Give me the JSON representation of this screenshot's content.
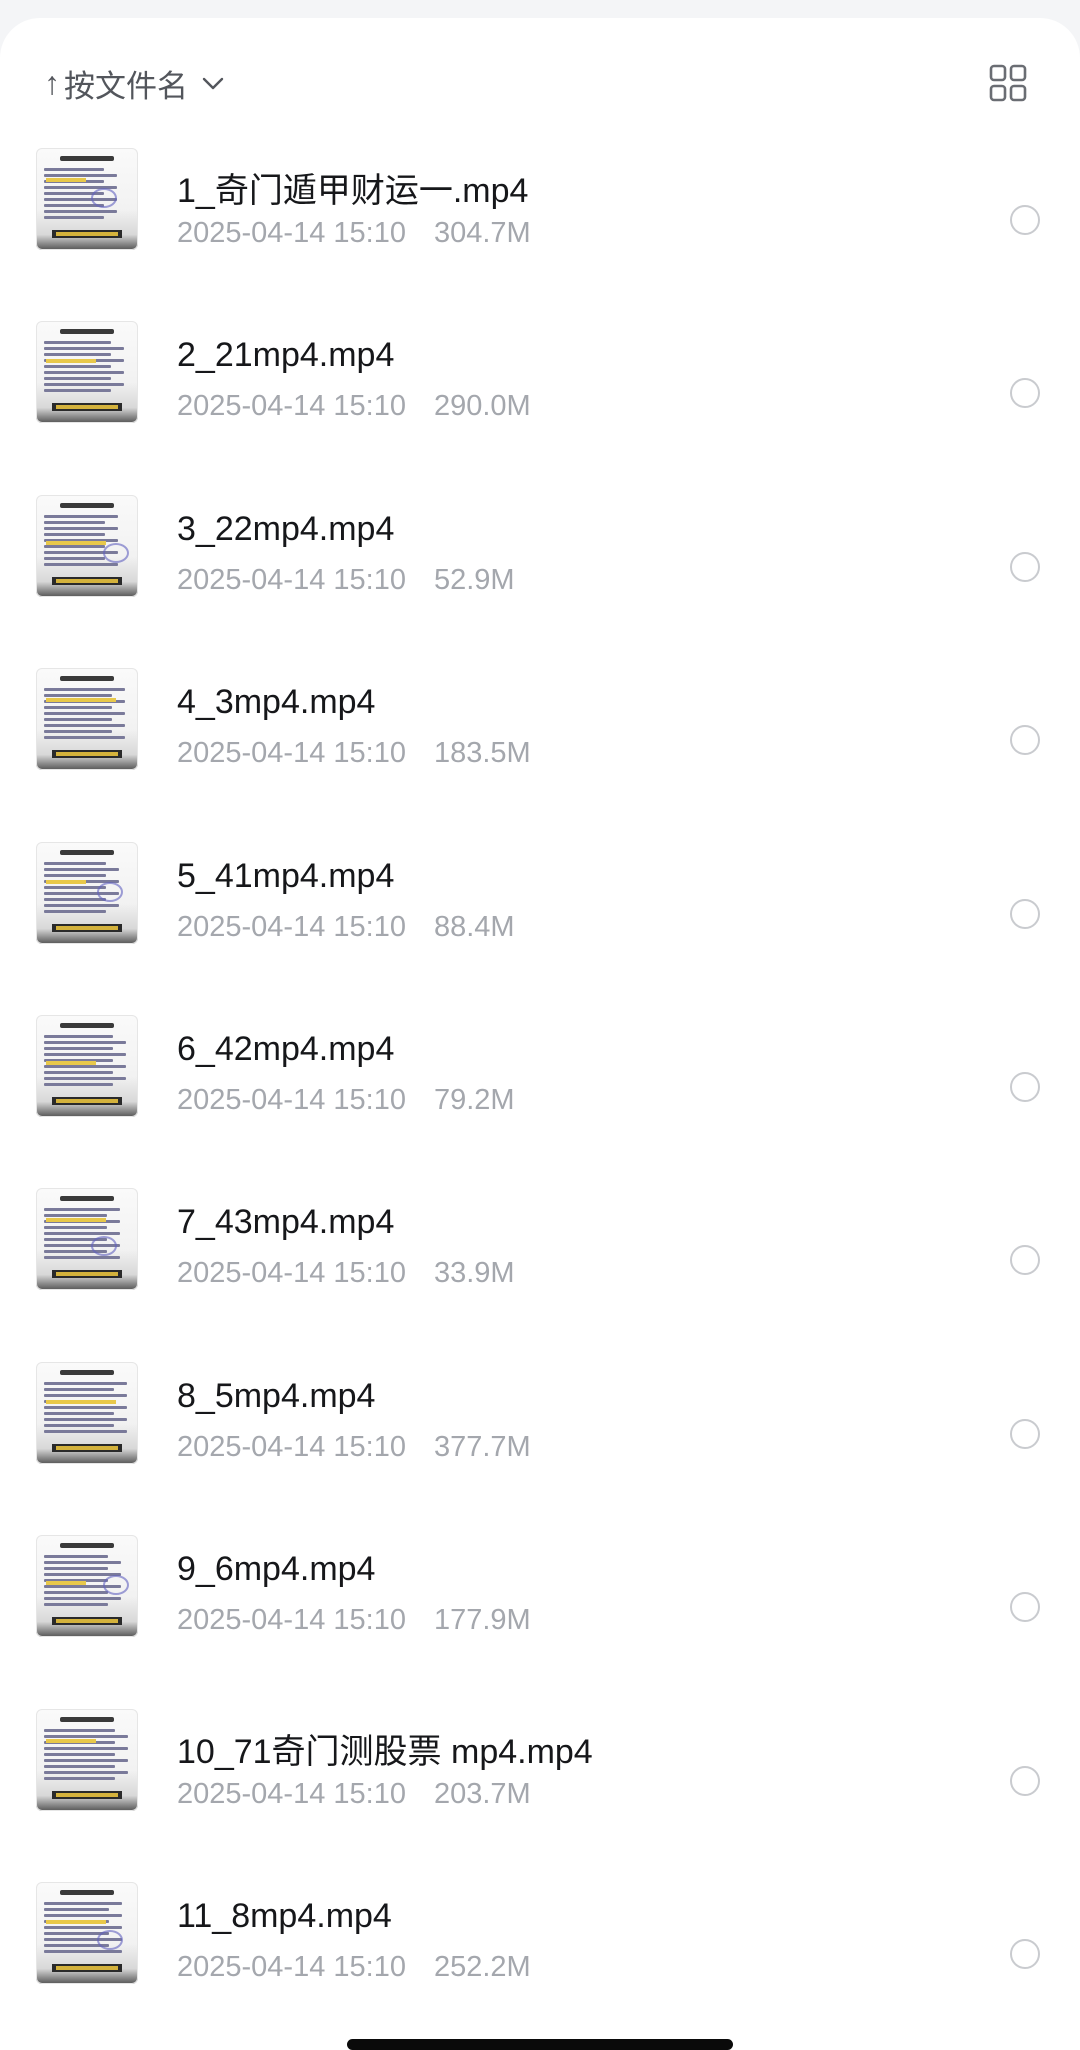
{
  "toolbar": {
    "sort_arrow": "↑",
    "sort_label": "按文件名",
    "sort_chevron_icon": "chevron-down-icon",
    "view_toggle_icon": "grid-view-icon"
  },
  "files": [
    {
      "name": "1_奇门遁甲财运一.mp4",
      "date": "2025-04-14 15:10",
      "size": "304.7M"
    },
    {
      "name": "2_21mp4.mp4",
      "date": "2025-04-14 15:10",
      "size": "290.0M"
    },
    {
      "name": "3_22mp4.mp4",
      "date": "2025-04-14 15:10",
      "size": "52.9M"
    },
    {
      "name": "4_3mp4.mp4",
      "date": "2025-04-14 15:10",
      "size": "183.5M"
    },
    {
      "name": "5_41mp4.mp4",
      "date": "2025-04-14 15:10",
      "size": "88.4M"
    },
    {
      "name": "6_42mp4.mp4",
      "date": "2025-04-14 15:10",
      "size": "79.2M"
    },
    {
      "name": "7_43mp4.mp4",
      "date": "2025-04-14 15:10",
      "size": "33.9M"
    },
    {
      "name": "8_5mp4.mp4",
      "date": "2025-04-14 15:10",
      "size": "377.7M"
    },
    {
      "name": "9_6mp4.mp4",
      "date": "2025-04-14 15:10",
      "size": "177.9M"
    },
    {
      "name": "10_71奇门测股票 mp4.mp4",
      "date": "2025-04-14 15:10",
      "size": "203.7M"
    },
    {
      "name": "11_8mp4.mp4",
      "date": "2025-04-14 15:10",
      "size": "252.2M"
    }
  ],
  "colors": {
    "text_primary": "#16171a",
    "text_secondary": "#a4a7ad",
    "icon": "#53565c",
    "radio_border": "#c9cbcf"
  }
}
